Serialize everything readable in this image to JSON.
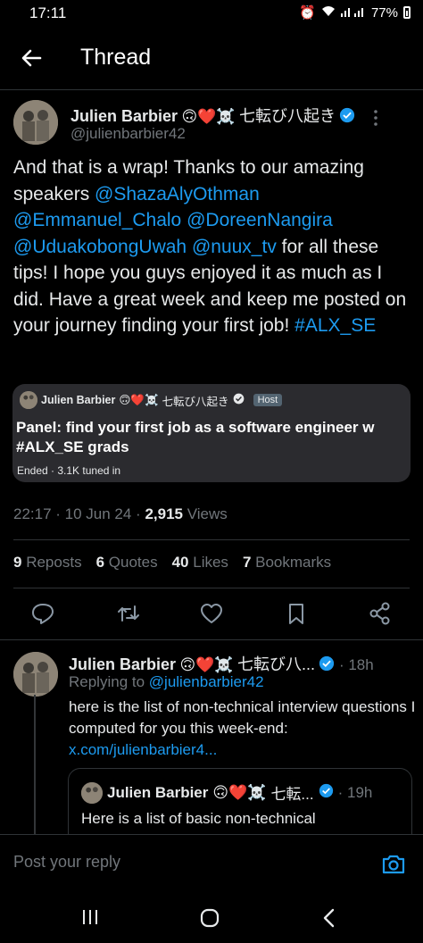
{
  "status": {
    "time": "17:11",
    "battery": "77%"
  },
  "header": {
    "title": "Thread"
  },
  "tweet": {
    "author": "Julien Barbier",
    "emojis": "🙃❤️☠️",
    "author_suffix": "七転び八起き",
    "handle": "@julienbarbier42",
    "text_plain_1": "And that is a wrap! Thanks to our amazing speakers ",
    "mention_1": "@ShazaAlyOthman",
    "mention_2": "@Emmanuel_Chalo",
    "mention_3": "@DoreenNangira",
    "mention_4": "@UduakobongUwah",
    "mention_5": "@nuux_tv",
    "text_plain_2": " for all these tips! I hope you guys enjoyed it as much as I did. Have a great week and keep me posted on your journey finding your first job! ",
    "hashtag": "#ALX_SE",
    "space_card": {
      "host_name": "Julien Barbier",
      "host_emojis": "🙃❤️☠️",
      "host_suffix": "七転び八起き",
      "host_badge": "Host",
      "title": "Panel: find your first job as a software engineer w #ALX_SE grads",
      "meta": "Ended · 3.1K tuned in"
    },
    "timestamp": "22:17 · 10 Jun 24 · ",
    "views_count": "2,915",
    "views_label": " Views",
    "reposts_count": "9",
    "reposts_label": "Reposts",
    "quotes_count": "6",
    "quotes_label": "Quotes",
    "likes_count": "40",
    "likes_label": "Likes",
    "bookmarks_count": "7",
    "bookmarks_label": "Bookmarks"
  },
  "reply": {
    "author": "Julien Barbier",
    "emojis": "🙃❤️☠️",
    "author_suffix": "七転び八...",
    "time": "· 18h",
    "replying_label": "Replying to ",
    "replying_handle": "@julienbarbier42",
    "text": "here is the list of non-technical interview questions I computed for you this week-end: ",
    "link": "x.com/julienbarbier4...",
    "quote": {
      "author": "Julien Barbier",
      "emojis": "🙃❤️☠️",
      "author_suffix": "七転...",
      "time": "· 19h",
      "text": "Here is a list of basic non-technical"
    }
  },
  "compose": {
    "placeholder": "Post your reply"
  }
}
